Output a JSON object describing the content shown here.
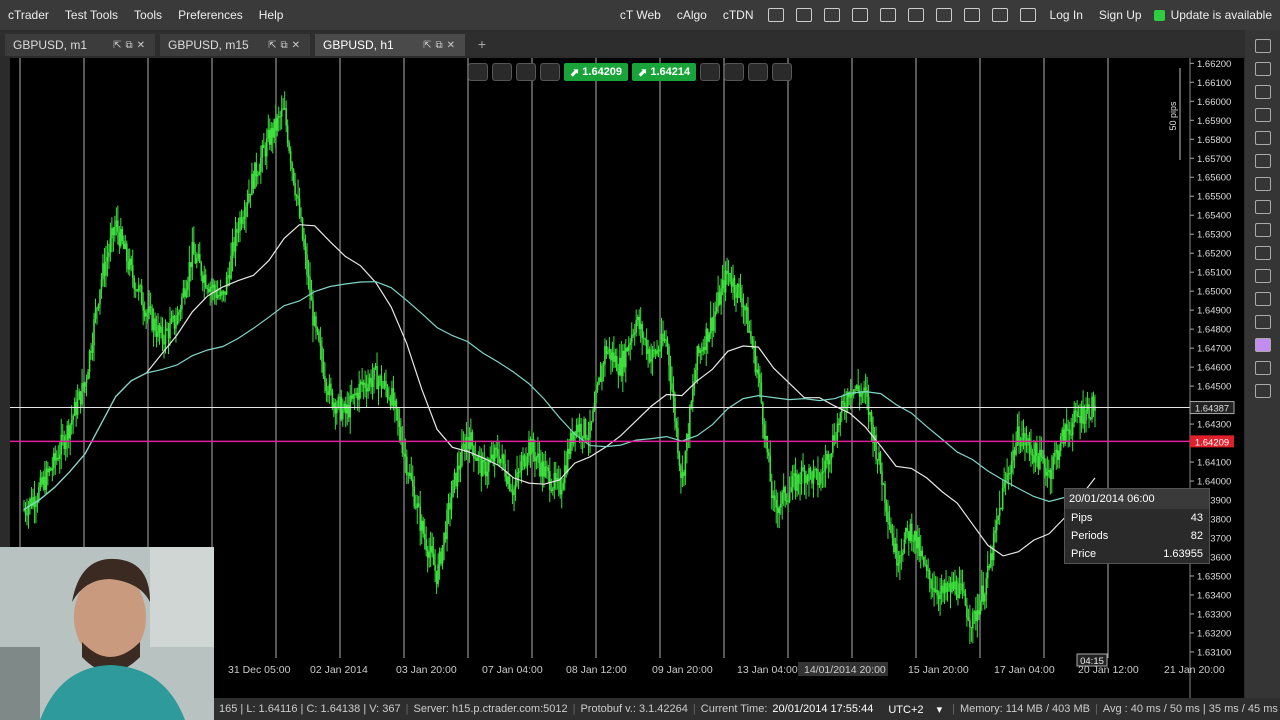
{
  "menu": {
    "left": [
      "cTrader",
      "Test Tools",
      "Tools",
      "Preferences",
      "Help"
    ],
    "right": [
      "cT Web",
      "cAlgo",
      "cTDN"
    ],
    "login": "Log In",
    "signup": "Sign Up",
    "update": "Update is available",
    "icons": [
      "book-icon",
      "video-icon",
      "chat-icon",
      "settings-gear-icon",
      "hand-up-icon",
      "hand-check-icon",
      "volume-icon",
      "language-icon",
      "window-icon",
      "resize-icon"
    ]
  },
  "tabs": [
    {
      "label": "GBPUSD, m1",
      "active": false
    },
    {
      "label": "GBPUSD, m15",
      "active": false
    },
    {
      "label": "GBPUSD, h1",
      "active": true
    }
  ],
  "toolbar": {
    "sell_price": "1.64209",
    "buy_price": "1.64214"
  },
  "chart_data": {
    "type": "candlestick",
    "symbol": "GBPUSD",
    "timeframe": "h1",
    "y_ticks": [
      "1.66200",
      "1.66100",
      "1.66000",
      "1.65900",
      "1.65800",
      "1.65700",
      "1.65600",
      "1.65500",
      "1.65400",
      "1.65300",
      "1.65200",
      "1.65100",
      "1.65000",
      "1.64900",
      "1.64800",
      "1.64700",
      "1.64600",
      "1.64500",
      "1.64400",
      "1.64300",
      "1.64200",
      "1.64100",
      "1.64000",
      "1.63900",
      "1.63800",
      "1.63700",
      "1.63600",
      "1.63500",
      "1.63400",
      "1.63300",
      "1.63200",
      "1.63100"
    ],
    "ylim": [
      1.6305,
      1.6625
    ],
    "x_ticks": [
      "31 Dec 05:00",
      "02 Jan 2014",
      "03 Jan 20:00",
      "07 Jan 04:00",
      "08 Jan 12:00",
      "09 Jan 20:00",
      "13 Jan 04:00",
      "14/01/2014 20:00",
      "15 Jan 20:00",
      "17 Jan 04:00",
      "20 Jan 12:00",
      "21 Jan 20:00"
    ],
    "close_path": [
      1.6385,
      1.6395,
      1.641,
      1.643,
      1.6452,
      1.6505,
      1.6535,
      1.651,
      1.649,
      1.6475,
      1.6485,
      1.652,
      1.6505,
      1.6495,
      1.6535,
      1.656,
      1.658,
      1.6595,
      1.654,
      1.648,
      1.6445,
      1.6435,
      1.645,
      1.6455,
      1.6445,
      1.641,
      1.6375,
      1.635,
      1.6395,
      1.6425,
      1.6405,
      1.6415,
      1.6395,
      1.642,
      1.6405,
      1.6395,
      1.643,
      1.6425,
      1.647,
      1.646,
      1.6485,
      1.6465,
      1.6475,
      1.64,
      1.6465,
      1.6485,
      1.651,
      1.6495,
      1.6455,
      1.6385,
      1.6395,
      1.6405,
      1.64,
      1.6425,
      1.645,
      1.6445,
      1.6405,
      1.636,
      1.6375,
      1.635,
      1.634,
      1.6345,
      1.6325,
      1.635,
      1.6395,
      1.6425,
      1.6415,
      1.6405,
      1.6425,
      1.6435,
      1.644
    ],
    "horizontal_lines": {
      "marker": "1.64387",
      "current": "1.64209"
    },
    "ruler": "50 pips",
    "crosshair_time": "04:15"
  },
  "tooltip": {
    "time": "20/01/2014 06:00",
    "rows": [
      {
        "label": "Pips",
        "value": "43"
      },
      {
        "label": "Periods",
        "value": "82"
      },
      {
        "label": "Price",
        "value": "1.63955"
      }
    ]
  },
  "statusbar": {
    "ohlc_tail": "165 | L: 1.64116 | C: 1.64138 | V: 367",
    "server": "Server: h15.p.ctrader.com:5012",
    "protobuf": "Protobuf v.: 3.1.42264",
    "current_time_label": "Current Time:",
    "current_time": "20/01/2014 17:55:44",
    "timezone": "UTC+2",
    "memory": "Memory: 114 MB / 403 MB",
    "avg": "Avg : 40 ms / 50 ms | 35 ms / 45 ms"
  },
  "colors": {
    "candle": "#3ee03e",
    "ma_white": "#e8e8e8",
    "ma_cyan": "#7ed6c8",
    "current_line": "#e0209a",
    "price_tag": "#e0202a",
    "accent_green": "#19a43a"
  }
}
